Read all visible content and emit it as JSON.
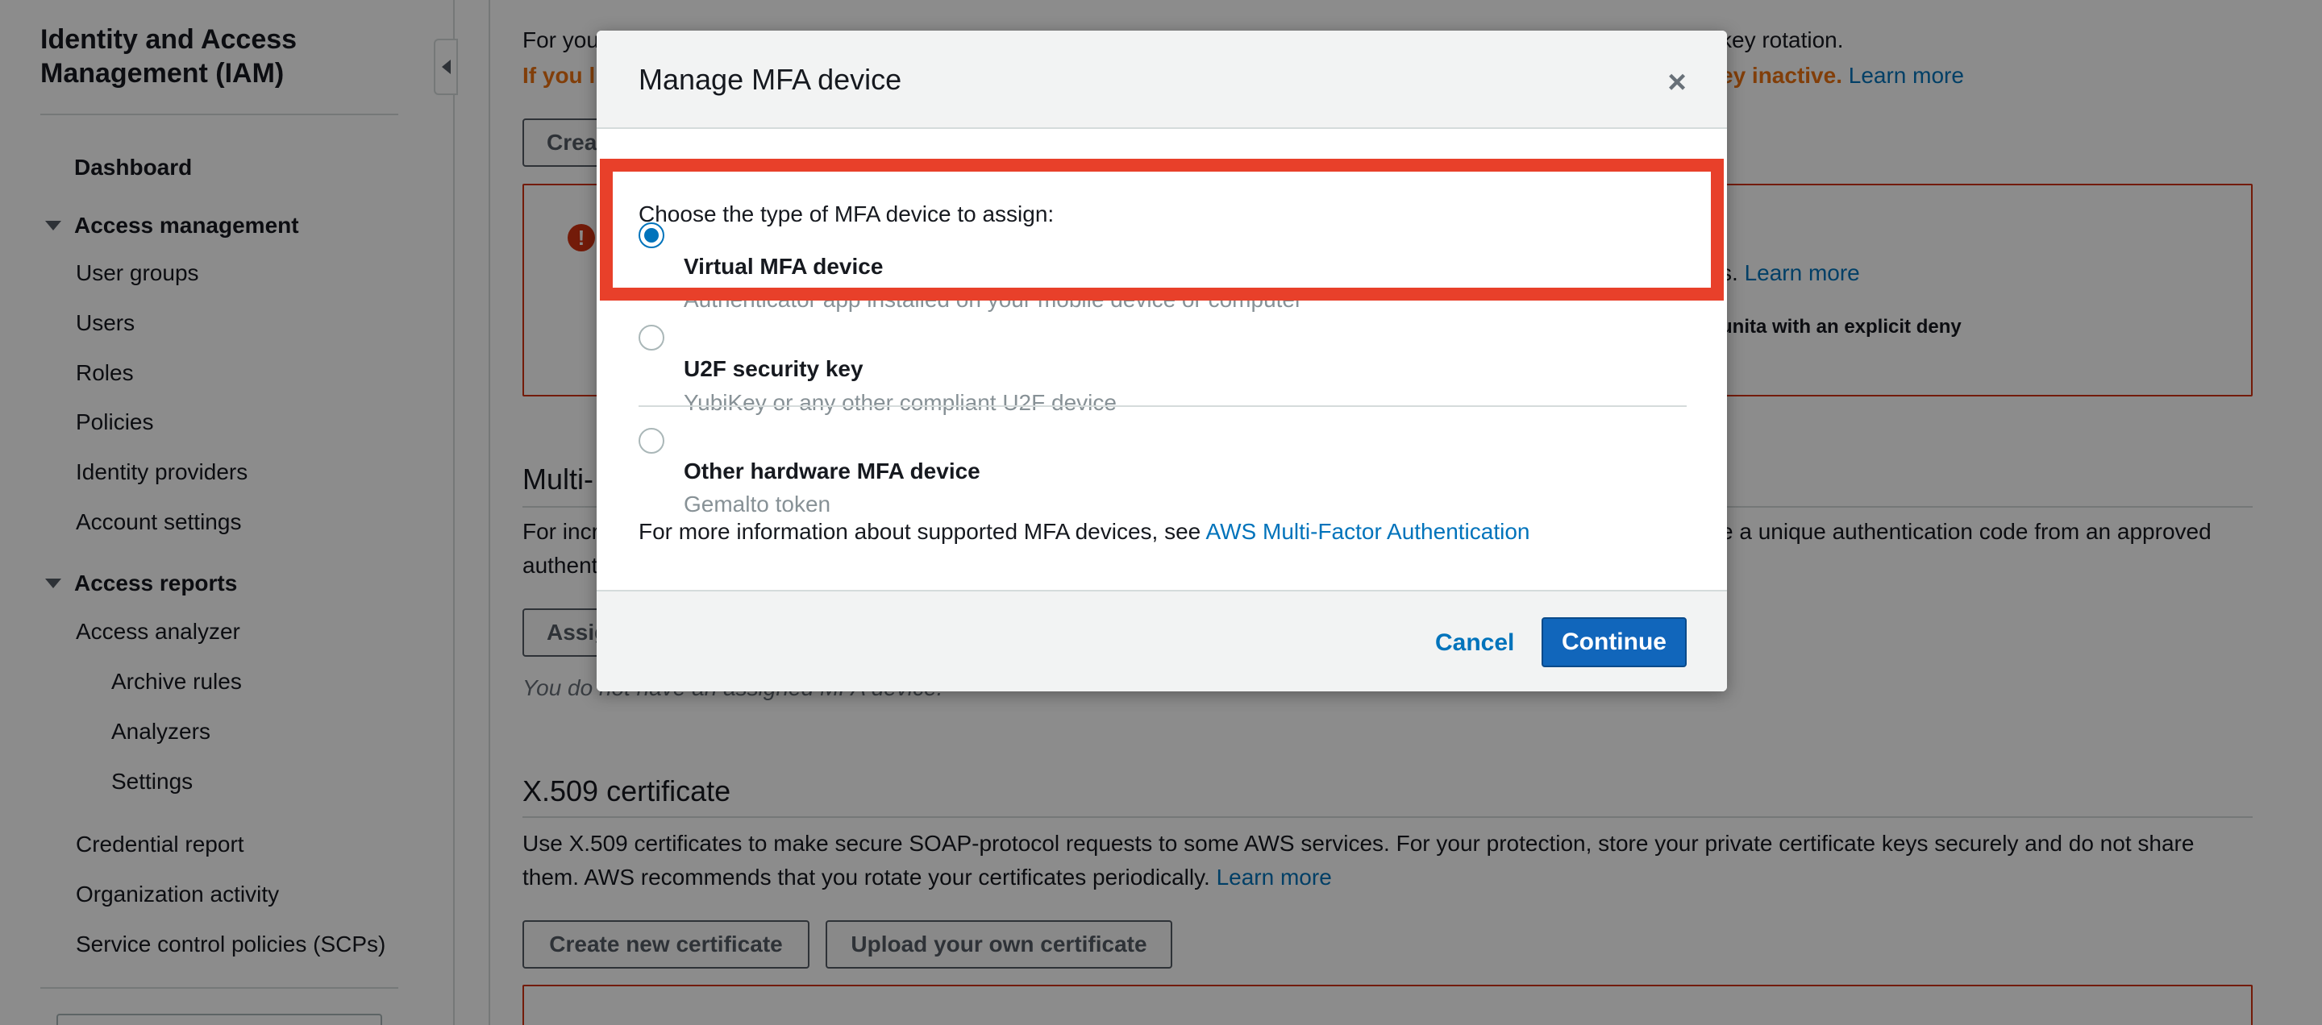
{
  "sidebar": {
    "title": "Identity and Access Management (IAM)",
    "dashboard": "Dashboard",
    "access_management": {
      "heading": "Access management",
      "items": [
        "User groups",
        "Users",
        "Roles",
        "Policies",
        "Identity providers",
        "Account settings"
      ]
    },
    "access_reports": {
      "heading": "Access reports",
      "analyzer": "Access analyzer",
      "analyzer_items": [
        "Archive rules",
        "Analyzers",
        "Settings"
      ],
      "more_items": [
        "Credential report",
        "Organization activity",
        "Service control policies (SCPs)"
      ]
    }
  },
  "main": {
    "access_keys": {
      "line1_start": "For you",
      "line1_end": "key rotation.",
      "line2_warn_start": "If you l",
      "line2_warn_end": "ey inactive.",
      "learn_more": "Learn more",
      "create_btn": "Crea",
      "error": {
        "line1_end": "s.",
        "learn_more": "Learn more",
        "line2_end": "unita with an explicit deny"
      }
    },
    "mfa_section": {
      "heading": "Multi-",
      "text_start": "For incr",
      "text_end": "e a unique authentication code from an approved",
      "text_line2": "authent",
      "assign_btn": "Assig",
      "no_device": "You do not have an assigned MFA device."
    },
    "x509": {
      "heading": "X.509 certificate",
      "text": "Use X.509 certificates to make secure SOAP-protocol requests to some AWS services. For your protection, store your private certificate keys securely and do not share them. AWS recommends that you rotate your certificates periodically.",
      "learn_more": "Learn more",
      "create_btn": "Create new certificate",
      "upload_btn": "Upload your own certificate"
    }
  },
  "modal": {
    "title": "Manage MFA device",
    "close_glyph": "×",
    "prompt": "Choose the type of MFA device to assign:",
    "options": [
      {
        "label": "Virtual MFA device",
        "desc": "Authenticator app installed on your mobile device or computer",
        "selected": true
      },
      {
        "label": "U2F security key",
        "desc": "YubiKey or any other compliant U2F device",
        "selected": false
      },
      {
        "label": "Other hardware MFA device",
        "desc": "Gemalto token",
        "selected": false
      }
    ],
    "info_text": "For more information about supported MFA devices, see",
    "info_link": "AWS Multi-Factor Authentication",
    "cancel": "Cancel",
    "continue": "Continue"
  },
  "colors": {
    "highlight": "#e8402a",
    "primary": "#1166bb",
    "link": "#0073bb",
    "warning": "#ec7211",
    "error": "#d13212"
  },
  "icons": {
    "collapse": "caret-left-icon",
    "close": "close-icon",
    "error": "exclamation-icon",
    "section_toggle": "caret-down-icon"
  }
}
